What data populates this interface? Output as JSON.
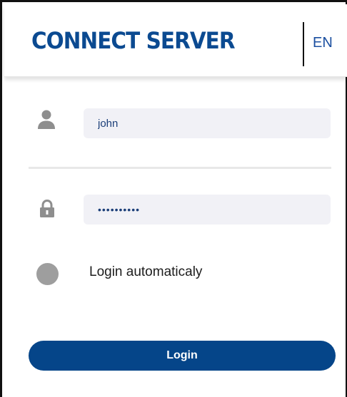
{
  "header": {
    "title": "CONNECT SERVER",
    "language": "EN"
  },
  "form": {
    "username_icon": "user-icon",
    "username_value": "john",
    "password_icon": "lock-icon",
    "password_value": "password12",
    "auto_login_label": "Login automaticaly",
    "auto_login_checked": false,
    "login_label": "Login"
  },
  "colors": {
    "brand": "#0b4a91",
    "button": "#054589",
    "icon": "#8e8e8e",
    "input_background": "#f1f1f6"
  }
}
